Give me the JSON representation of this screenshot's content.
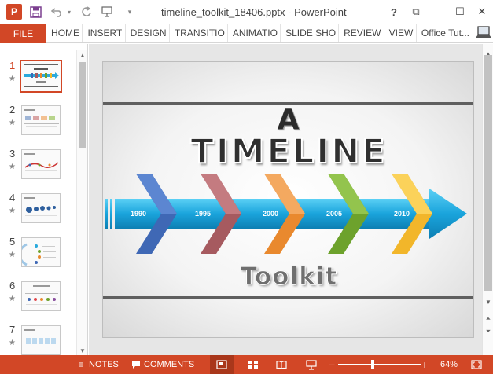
{
  "window": {
    "title": "timeline_toolkit_18406.pptx - PowerPoint",
    "app_icon_text": "P",
    "help": "?",
    "restore_icon": "⧉",
    "minimize": "—",
    "maximize": "☐",
    "close": "✕"
  },
  "qat": {
    "save_icon": "save-icon",
    "undo_icon": "undo-icon",
    "redo_icon": "redo-icon",
    "present_icon": "start-from-beginning-icon",
    "customize_icon": "customize-qat-icon"
  },
  "ribbon": {
    "file": "FILE",
    "tabs": [
      "HOME",
      "INSERT",
      "DESIGN",
      "TRANSITIO",
      "ANIMATIO",
      "SLIDE SHO",
      "REVIEW",
      "VIEW"
    ],
    "account": "Office Tut..."
  },
  "thumbnails": [
    {
      "number": "1",
      "star": "★",
      "active": true
    },
    {
      "number": "2",
      "star": "★",
      "active": false
    },
    {
      "number": "3",
      "star": "★",
      "active": false
    },
    {
      "number": "4",
      "star": "★",
      "active": false
    },
    {
      "number": "5",
      "star": "★",
      "active": false
    },
    {
      "number": "6",
      "star": "★",
      "active": false
    },
    {
      "number": "7",
      "star": "★",
      "active": false
    }
  ],
  "slide": {
    "line1": "A",
    "line2": "TIMELINE",
    "line3": "Toolkit",
    "years": [
      "1990",
      "1995",
      "2000",
      "2005",
      "2010"
    ],
    "chevron_colors": [
      "#3f68b5",
      "#a65a5f",
      "#e9892e",
      "#6da22c",
      "#f2b62a"
    ],
    "arrow_color": "#1fa5d8"
  },
  "statusbar": {
    "notes": "NOTES",
    "comments": "COMMENTS",
    "zoom_out": "−",
    "zoom_in": "+",
    "zoom_level": "64%",
    "zoom_fraction": 0.42
  }
}
